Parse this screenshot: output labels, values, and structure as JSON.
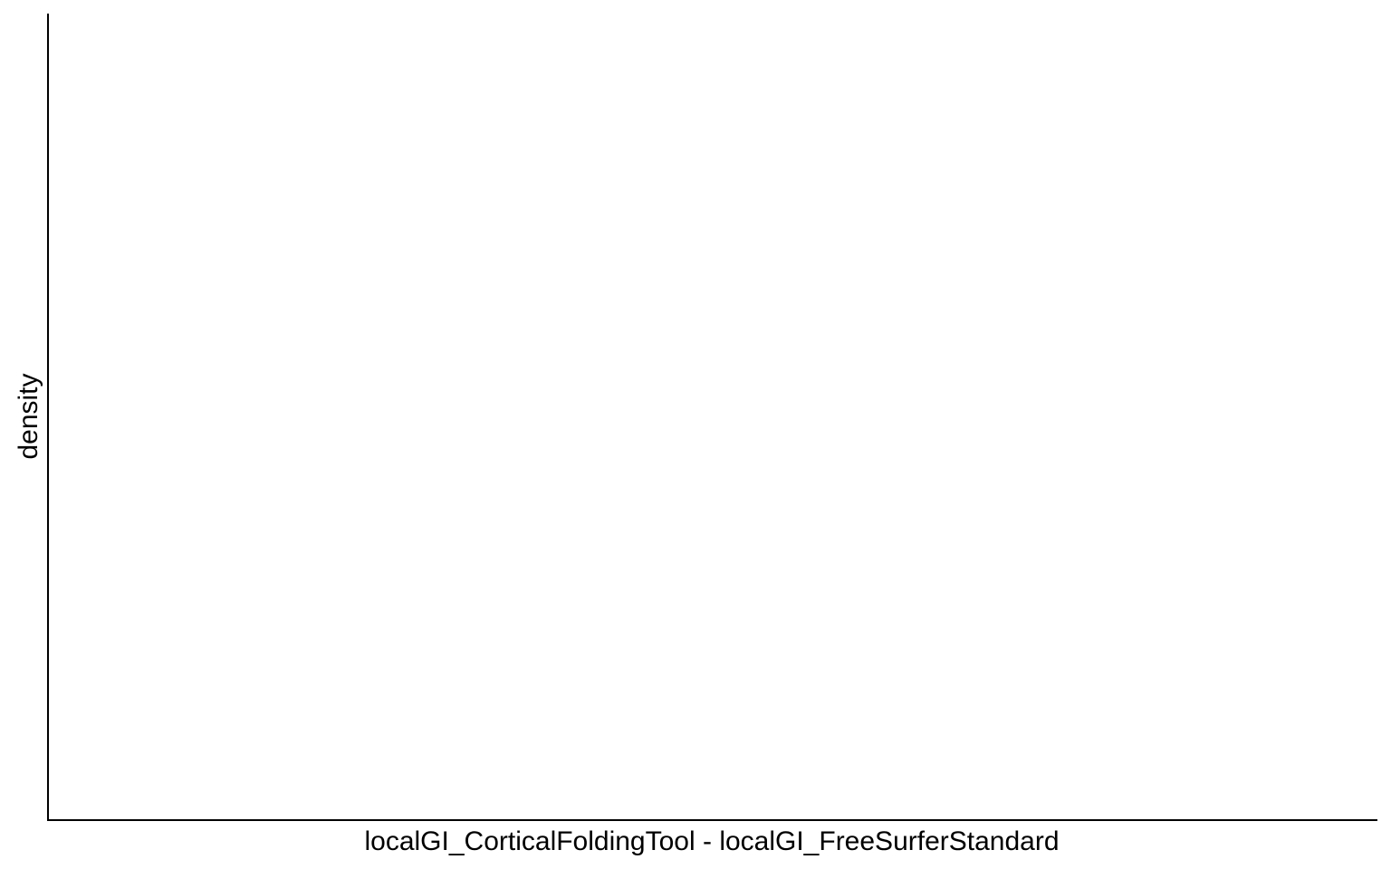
{
  "chart_data": {
    "type": "area",
    "title": "",
    "xlabel": "localGI_CorticalFoldingTool - localGI_FreeSurferStandard",
    "ylabel": "density",
    "x_tick_labels": [],
    "y_tick_labels": [],
    "series": [],
    "grid": false,
    "legend": "none",
    "colors": {
      "axis": "#000000",
      "background": "#ffffff",
      "text": "#000000"
    }
  }
}
